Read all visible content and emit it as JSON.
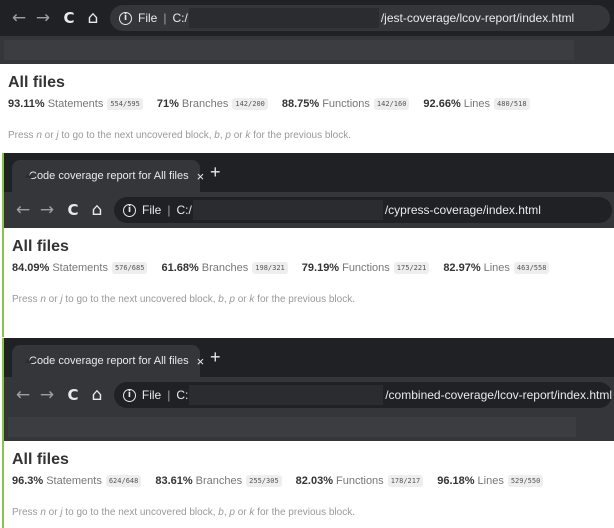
{
  "browser": {
    "file_label": "File",
    "sep": "|",
    "new_tab": "+",
    "tab_close": "×"
  },
  "panels": [
    {
      "tab_title": "",
      "url_start": "C:/",
      "url_rest": "/jest-coverage/lcov-report/index.html",
      "heading": "All files",
      "stats": [
        {
          "pct": "93.11%",
          "label": "Statements",
          "frac": "554/595"
        },
        {
          "pct": "71%",
          "label": "Branches",
          "frac": "142/200"
        },
        {
          "pct": "88.75%",
          "label": "Functions",
          "frac": "142/160"
        },
        {
          "pct": "92.66%",
          "label": "Lines",
          "frac": "480/518"
        }
      ]
    },
    {
      "tab_title": "Code coverage report for All files",
      "url_start": "C:/",
      "url_rest": "/cypress-coverage/index.html",
      "heading": "All files",
      "stats": [
        {
          "pct": "84.09%",
          "label": "Statements",
          "frac": "576/685"
        },
        {
          "pct": "61.68%",
          "label": "Branches",
          "frac": "198/321"
        },
        {
          "pct": "79.19%",
          "label": "Functions",
          "frac": "175/221"
        },
        {
          "pct": "82.97%",
          "label": "Lines",
          "frac": "463/558"
        }
      ]
    },
    {
      "tab_title": "Code coverage report for All files",
      "url_start": "C:",
      "url_rest": "/combined-coverage/lcov-report/index.html",
      "heading": "All files",
      "stats": [
        {
          "pct": "96.3%",
          "label": "Statements",
          "frac": "624/648"
        },
        {
          "pct": "83.61%",
          "label": "Branches",
          "frac": "255/305"
        },
        {
          "pct": "82.03%",
          "label": "Functions",
          "frac": "178/217"
        },
        {
          "pct": "96.18%",
          "label": "Lines",
          "frac": "529/550"
        }
      ]
    }
  ],
  "hint": {
    "a": "Press ",
    "n": "n",
    "b": " or ",
    "j": "j",
    "c": " to go to the next uncovered block, ",
    "bkey": "b",
    "d": ", ",
    "p": "p",
    "e": " or ",
    "k": "k",
    "f": " for the previous block."
  },
  "icons": {
    "back": "←",
    "forward": "→",
    "reload": "C",
    "home": "⌂",
    "info": "i"
  },
  "colors": {
    "accent_green": "#8bc34a",
    "chrome_dark": "#202124",
    "chrome_toolbar": "#35363a"
  }
}
